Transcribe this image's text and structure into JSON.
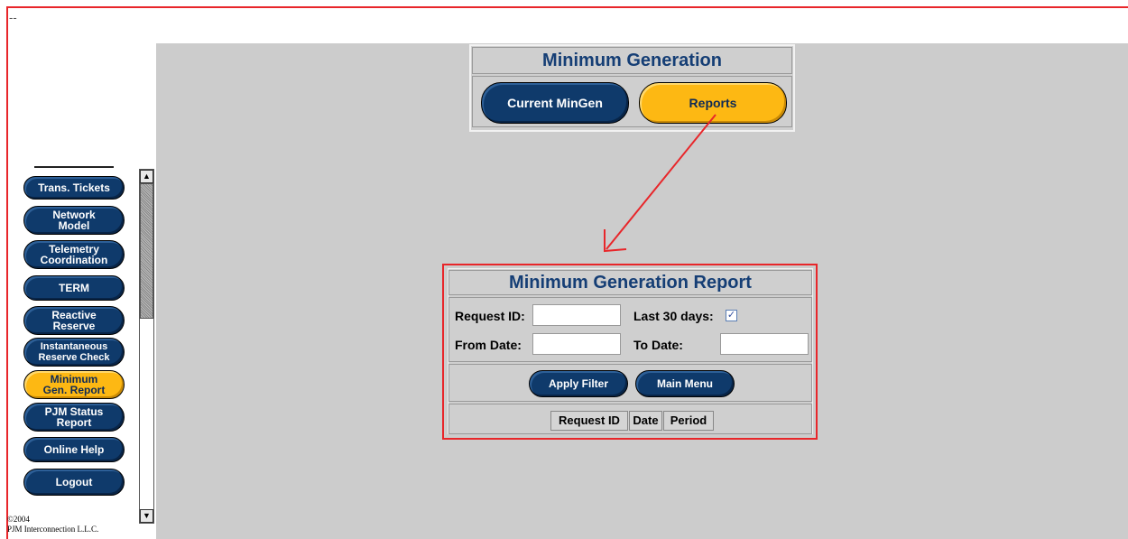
{
  "top_marker": "--",
  "sidebar": {
    "items": [
      {
        "label": "Trans. Tickets"
      },
      {
        "label": "Network Model"
      },
      {
        "label": "Telemetry Coordination"
      },
      {
        "label": "TERM"
      },
      {
        "label": "Reactive Reserve"
      },
      {
        "label": "Instantaneous Reserve Check"
      },
      {
        "label": "Minimum Gen. Report",
        "active": true
      },
      {
        "label": "PJM Status Report"
      },
      {
        "label": "Online Help"
      },
      {
        "label": "Logout"
      }
    ],
    "scroll_up_glyph": "▲",
    "scroll_down_glyph": "▼"
  },
  "footer": {
    "copyright": "©2004",
    "company": "PJM Interconnection L.L.C."
  },
  "header_panel": {
    "title": "Minimum Generation",
    "tabs": [
      {
        "label": "Current MinGen"
      },
      {
        "label": "Reports",
        "active": true
      }
    ]
  },
  "report_panel": {
    "title": "Minimum Generation Report",
    "request_id_label": "Request ID:",
    "request_id_value": "",
    "last30_label": "Last 30 days:",
    "last30_checked": true,
    "from_date_label": "From Date:",
    "from_date_value": "",
    "to_date_label": "To Date:",
    "to_date_value": "",
    "apply_filter_label": "Apply Filter",
    "main_menu_label": "Main Menu",
    "columns": [
      "Request ID",
      "Date",
      "Period"
    ]
  },
  "colors": {
    "accent_red": "#e8262a",
    "nav_blue": "#0f3a6b",
    "active_gold": "#fdb813",
    "title_blue": "#153e75",
    "panel_gray": "#cccccc"
  }
}
